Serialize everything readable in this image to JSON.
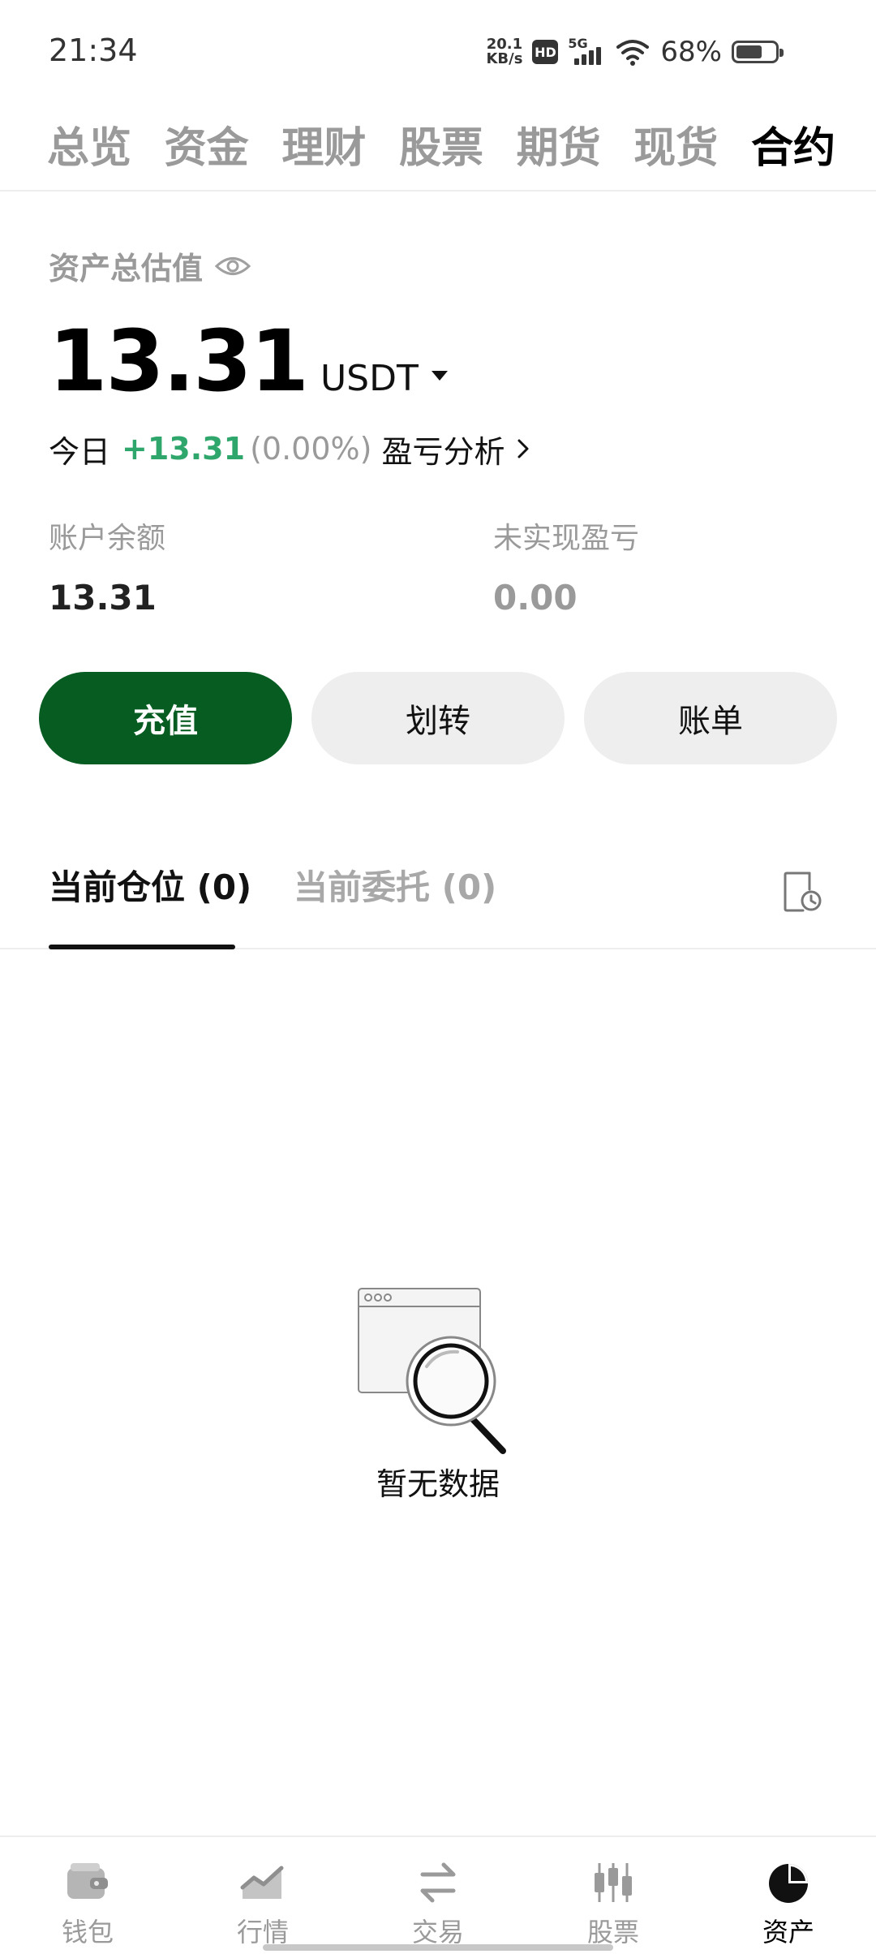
{
  "status_bar": {
    "time": "21:34",
    "net_speed_value": "20.1",
    "net_speed_unit": "KB/s",
    "hd_badge": "HD",
    "network_type": "5G",
    "battery_percent": "68%",
    "battery_level": 0.68
  },
  "top_tabs": [
    {
      "label": "总览",
      "active": false
    },
    {
      "label": "资金",
      "active": false
    },
    {
      "label": "理财",
      "active": false
    },
    {
      "label": "股票",
      "active": false
    },
    {
      "label": "期货",
      "active": false
    },
    {
      "label": "现货",
      "active": false
    },
    {
      "label": "合约",
      "active": true
    }
  ],
  "asset": {
    "label": "资产总估值",
    "total_value": "13.31",
    "currency": "USDT",
    "today_label": "今日",
    "today_change": "+13.31",
    "today_change_pct": "(0.00%)",
    "pnl_analysis_label": "盈亏分析"
  },
  "stats": {
    "balance_label": "账户余额",
    "balance_value": "13.31",
    "unrealized_label": "未实现盈亏",
    "unrealized_value": "0.00"
  },
  "actions": {
    "deposit": "充值",
    "transfer": "划转",
    "bill": "账单"
  },
  "position_tabs": {
    "current_positions": "当前仓位 (0)",
    "open_orders": "当前委托 (0)"
  },
  "empty_state": {
    "text": "暂无数据"
  },
  "bottom_nav": [
    {
      "label": "钱包",
      "icon": "wallet-icon",
      "active": false
    },
    {
      "label": "行情",
      "icon": "market-chart-icon",
      "active": false
    },
    {
      "label": "交易",
      "icon": "swap-arrows-icon",
      "active": false
    },
    {
      "label": "股票",
      "icon": "candlestick-icon",
      "active": false
    },
    {
      "label": "资产",
      "icon": "pie-chart-icon",
      "active": true
    }
  ],
  "colors": {
    "primary_green": "#075c22",
    "positive": "#2fa66b",
    "muted_text": "#9a9a9a",
    "button_gray": "#eeeeee"
  }
}
